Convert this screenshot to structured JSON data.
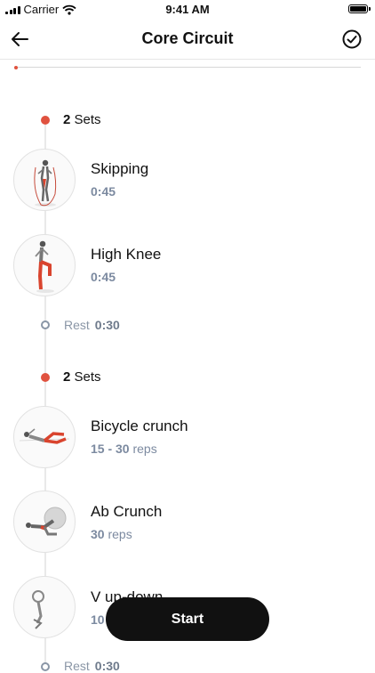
{
  "status_bar": {
    "carrier": "Carrier",
    "time": "9:41 AM"
  },
  "nav": {
    "title": "Core Circuit"
  },
  "progress": {
    "fraction": 0.0
  },
  "groups": [
    {
      "sets_count": "2",
      "sets_label": "Sets",
      "exercises": [
        {
          "name": "Skipping",
          "value": "0:45",
          "unit": ""
        },
        {
          "name": "High Knee",
          "value": "0:45",
          "unit": ""
        }
      ],
      "rest_label": "Rest",
      "rest_value": "0:30"
    },
    {
      "sets_count": "2",
      "sets_label": "Sets",
      "exercises": [
        {
          "name": "Bicycle crunch",
          "value": "15 - 30",
          "unit": "reps"
        },
        {
          "name": "Ab Crunch",
          "value": "30",
          "unit": "reps"
        },
        {
          "name": "V up-down",
          "value": "10",
          "unit": ""
        }
      ],
      "rest_label": "Rest",
      "rest_value": "0:30"
    }
  ],
  "start_button": {
    "label": "Start"
  },
  "colors": {
    "accent": "#e0523f",
    "muted": "#7c8aa0",
    "button": "#111111"
  }
}
